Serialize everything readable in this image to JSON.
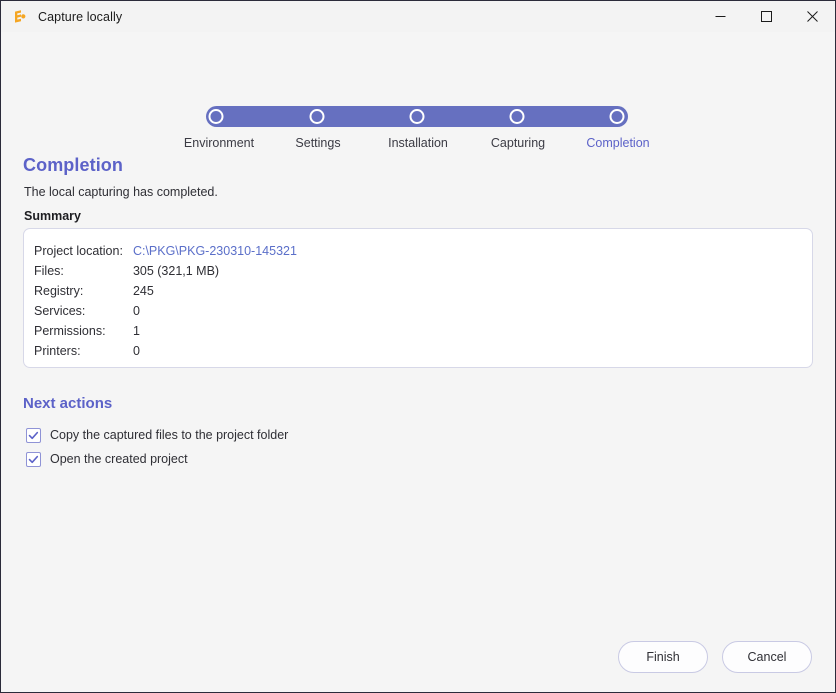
{
  "window": {
    "title": "Capture locally",
    "icon": "app-logo-icon",
    "controls": {
      "minimize": "minimize-icon",
      "maximize": "maximize-icon",
      "close": "close-icon"
    }
  },
  "colors": {
    "accent": "#5c62c8",
    "stepper_bar": "#6670c0",
    "link": "#5b6fc9",
    "page_background": "#f5f5f5",
    "box_border": "#d7d8e8",
    "button_border": "#c9cae4"
  },
  "stepper": {
    "steps": [
      {
        "label": "Environment",
        "active": false
      },
      {
        "label": "Settings",
        "active": false
      },
      {
        "label": "Installation",
        "active": false
      },
      {
        "label": "Capturing",
        "active": false
      },
      {
        "label": "Completion",
        "active": true
      }
    ]
  },
  "page": {
    "heading": "Completion",
    "subtitle": "The local capturing has completed.",
    "summary_label": "Summary"
  },
  "summary": {
    "rows": [
      {
        "key": "Project location:",
        "value": "C:\\PKG\\PKG-230310-145321",
        "is_link": true
      },
      {
        "key": "Files:",
        "value": "305 (321,1 MB)",
        "is_link": false
      },
      {
        "key": "Registry:",
        "value": "245",
        "is_link": false
      },
      {
        "key": "Services:",
        "value": "0",
        "is_link": false
      },
      {
        "key": "Permissions:",
        "value": "1",
        "is_link": false
      },
      {
        "key": "Printers:",
        "value": "0",
        "is_link": false
      }
    ]
  },
  "next_actions": {
    "heading": "Next actions",
    "items": [
      {
        "label": "Copy the captured files to the project folder",
        "checked": true
      },
      {
        "label": "Open the created project",
        "checked": true
      }
    ]
  },
  "footer": {
    "finish_label": "Finish",
    "cancel_label": "Cancel"
  }
}
